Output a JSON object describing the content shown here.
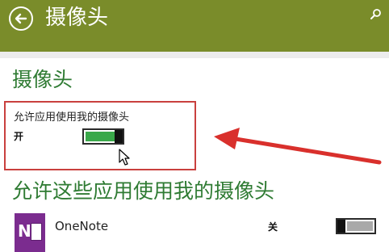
{
  "header": {
    "title": "摄像头",
    "back_icon": "back-arrow-icon",
    "search_icon": "search-icon",
    "background_color": "#7a8c2a"
  },
  "camera_section": {
    "title": "摄像头",
    "setting_label": "允许应用使用我的摄像头",
    "state_label": "开",
    "toggle_on": true,
    "accent_color": "#3aa84a",
    "highlight_color": "#c9403e"
  },
  "apps_section": {
    "title": "允许这些应用使用我的摄像头",
    "apps": [
      {
        "name": "OneNote",
        "icon": "onenote-icon",
        "state_label": "关",
        "toggle_on": false
      }
    ]
  }
}
